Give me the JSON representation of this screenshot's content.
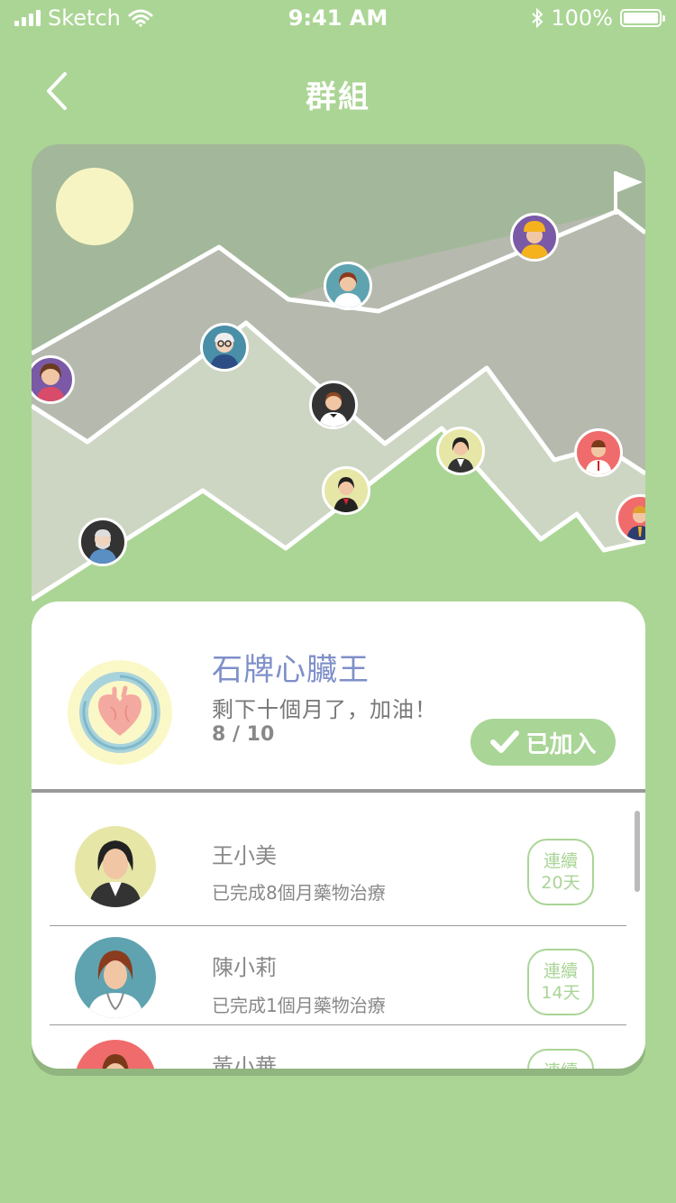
{
  "status_bar": {
    "carrier": "Sketch",
    "time": "9:41 AM",
    "battery": "100%"
  },
  "nav": {
    "title": "群組",
    "back_icon": "chevron-left-icon"
  },
  "colors": {
    "background": "#abd595",
    "accent": "#a9d596",
    "title_blue": "#7f8fc9",
    "sun": "#f7f4c4"
  },
  "challenge": {
    "title": "石牌心臟王",
    "message": "剩下十個月了，加油！",
    "progress": "8 / 10",
    "progress_value": 0.8,
    "joined_label": "已加入",
    "icon": "heart-icon"
  },
  "members": [
    {
      "name": "王小美",
      "desc": "已完成8個月藥物治療",
      "streak_top": "連續",
      "streak_bottom": "20天"
    },
    {
      "name": "陳小莉",
      "desc": "已完成1個月藥物治療",
      "streak_top": "連續",
      "streak_bottom": "14天"
    },
    {
      "name": "黃小華",
      "desc": "",
      "streak_top": "連續",
      "streak_bottom": ""
    }
  ]
}
